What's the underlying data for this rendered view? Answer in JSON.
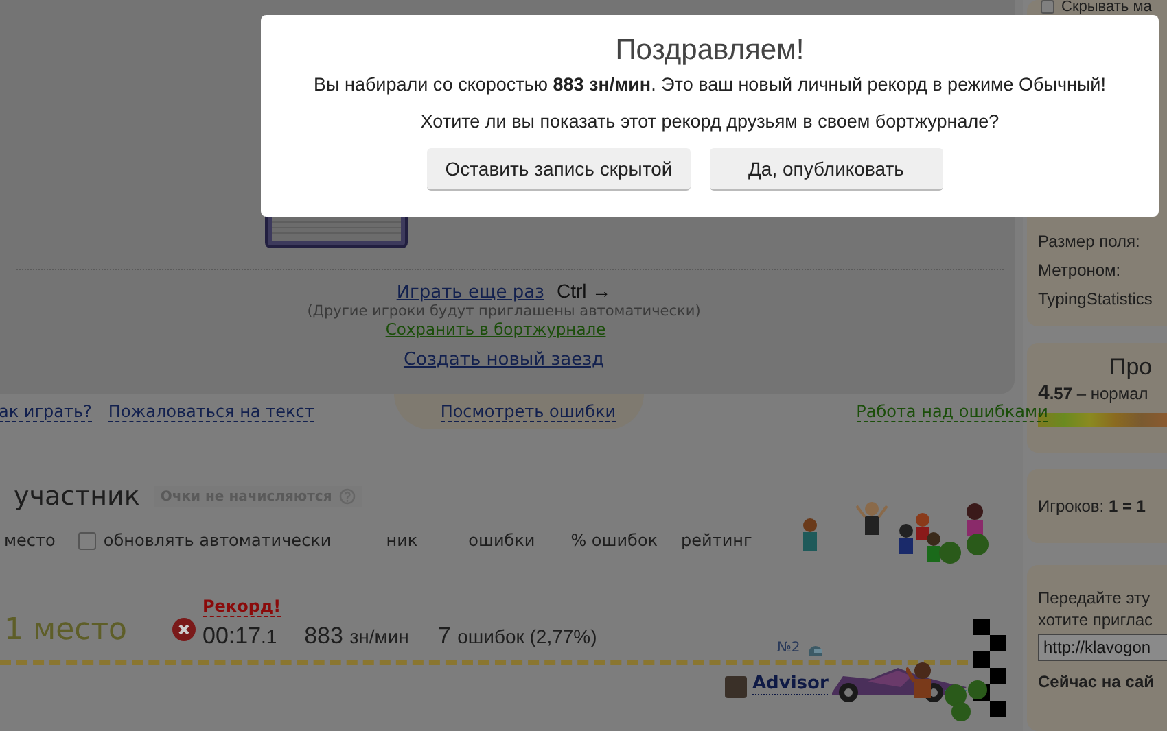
{
  "modal": {
    "title": "Поздравляем!",
    "message": "Вы набирали со скоростью **883 зн/мин**. Это ваш новый личный рекорд в режиме Обычный!",
    "question": "Хотите ли вы показать этот рекорд друзьям в своем бортжурнале?",
    "buttons": [
      "Оставить запись скрытой",
      "Да, опубликовать"
    ]
  },
  "result_panel": {
    "play_again": "Играть еще раз",
    "shortcut": "Ctrl →",
    "hint": "(Другие игроки будут приглашены автоматически)",
    "save_link": "Сохранить в бортжурнале",
    "new_race": "Создать новый заезд"
  },
  "links": {
    "how_to_play": "ак играть?",
    "complain": "Пожаловаться на текст",
    "view_errors": "Посмотреть ошибки",
    "error_work": "Работа над ошибками"
  },
  "participants": {
    "heading": "участник",
    "badge": "Очки не начисляются",
    "auto_update": {
      "label": "обновлять автоматически",
      "checked": false
    },
    "columns": [
      "место",
      "ник",
      "ошибки",
      "% ошибок",
      "рейтинг"
    ]
  },
  "result": {
    "place": "1 место",
    "record": "Рекорд!",
    "time": "00:17",
    "time_fraction": ".1",
    "speed": "883",
    "speed_unit": "зн/мин",
    "errors": "7",
    "errors_text": "ошибок (2,77%)",
    "number": "№2",
    "player": "Advisor"
  },
  "sidebar": {
    "hide_option": {
      "label": "Скрывать ма",
      "checked": false
    },
    "settings": [
      "Размер поля:",
      "Метроном:",
      "TypingStatistics"
    ],
    "stats_title": "Про",
    "rating": "4",
    "rating_fraction": ".57",
    "rating_text": "– нормал",
    "players": "Игроков: **1 = 1**",
    "invite_lines": [
      "Передайте эту",
      "хотите приглас"
    ],
    "invite_url": "http://klavogon",
    "online": "Сейчас на сай"
  }
}
